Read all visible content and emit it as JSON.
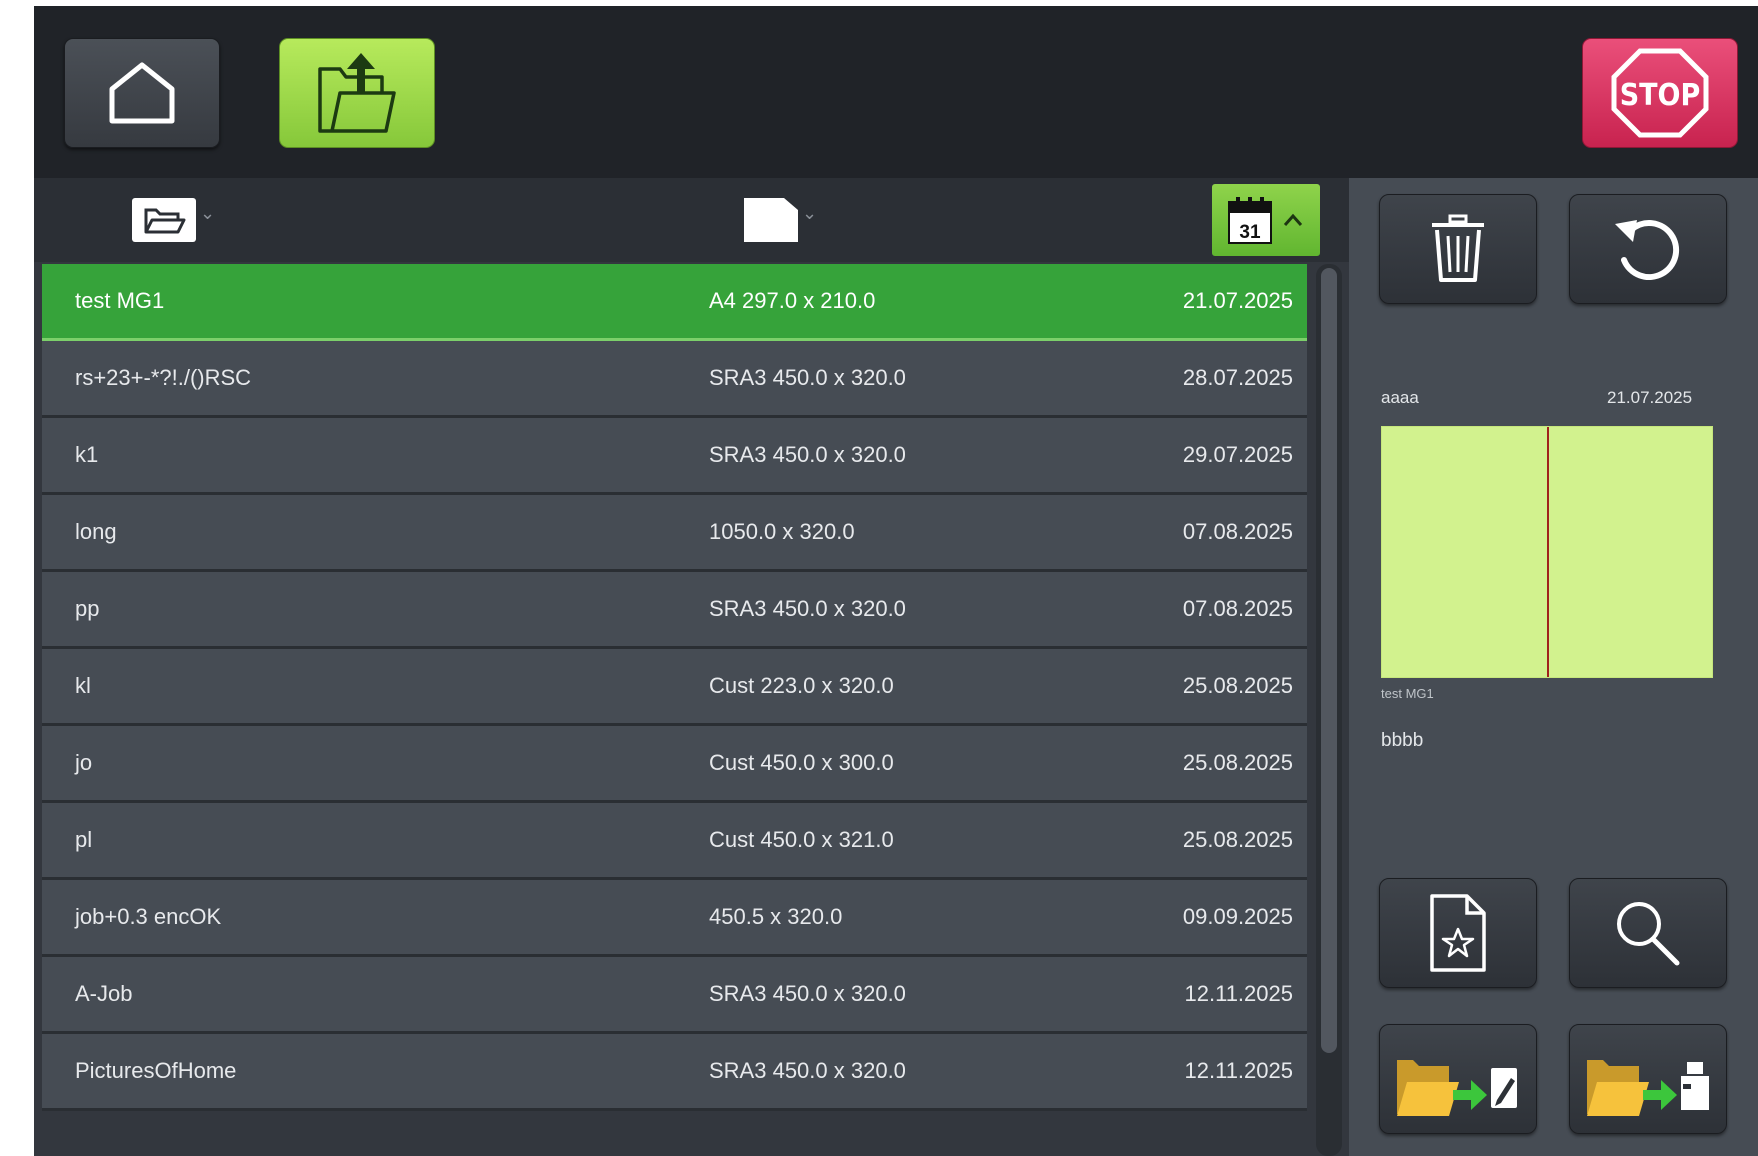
{
  "toolbar": {
    "stop_label": "STOP"
  },
  "list_header": {
    "date_icon_day": "31"
  },
  "jobs": [
    {
      "name": "test MG1",
      "size": "A4 297.0 x 210.0",
      "date": "21.07.2025",
      "selected": true
    },
    {
      "name": "rs+23+-*?!./()RSC",
      "size": "SRA3 450.0 x 320.0",
      "date": "28.07.2025"
    },
    {
      "name": "k1",
      "size": "SRA3 450.0 x 320.0",
      "date": "29.07.2025"
    },
    {
      "name": "long",
      "size": " 1050.0 x 320.0",
      "date": "07.08.2025"
    },
    {
      "name": "pp",
      "size": "SRA3 450.0 x 320.0",
      "date": "07.08.2025"
    },
    {
      "name": "kl",
      "size": "Cust 223.0 x 320.0",
      "date": "25.08.2025"
    },
    {
      "name": "jo",
      "size": "Cust 450.0 x 300.0",
      "date": "25.08.2025"
    },
    {
      "name": "pl",
      "size": "Cust 450.0 x 321.0",
      "date": "25.08.2025"
    },
    {
      "name": "job+0.3 encOK",
      "size": " 450.5 x 320.0",
      "date": "09.09.2025"
    },
    {
      "name": "A-Job",
      "size": "SRA3 450.0 x 320.0",
      "date": "12.11.2025"
    },
    {
      "name": "PicturesOfHome",
      "size": "SRA3 450.0 x 320.0",
      "date": "12.11.2025"
    }
  ],
  "preview": {
    "name": "aaaa",
    "date": "21.07.2025",
    "caption": "test MG1",
    "note": "bbbb"
  },
  "colors": {
    "accent_green": "#36a33a",
    "open_button": "#9bd84a",
    "stop_button": "#d83562",
    "preview_sheet": "#d2f28e",
    "preview_cutline": "#a0231c"
  },
  "icons": {
    "home": "home-icon",
    "open": "folder-upload-icon",
    "stop": "stop-sign-icon",
    "sort_folder": "open-folder-icon",
    "sort_paper": "paper-sheet-icon",
    "sort_date": "calendar-icon",
    "delete": "trash-icon",
    "reset": "undo-icon",
    "favorite": "favorite-document-icon",
    "search": "magnifier-icon",
    "export_edit": "folder-to-edit-icon",
    "export_print": "folder-to-printer-icon"
  }
}
